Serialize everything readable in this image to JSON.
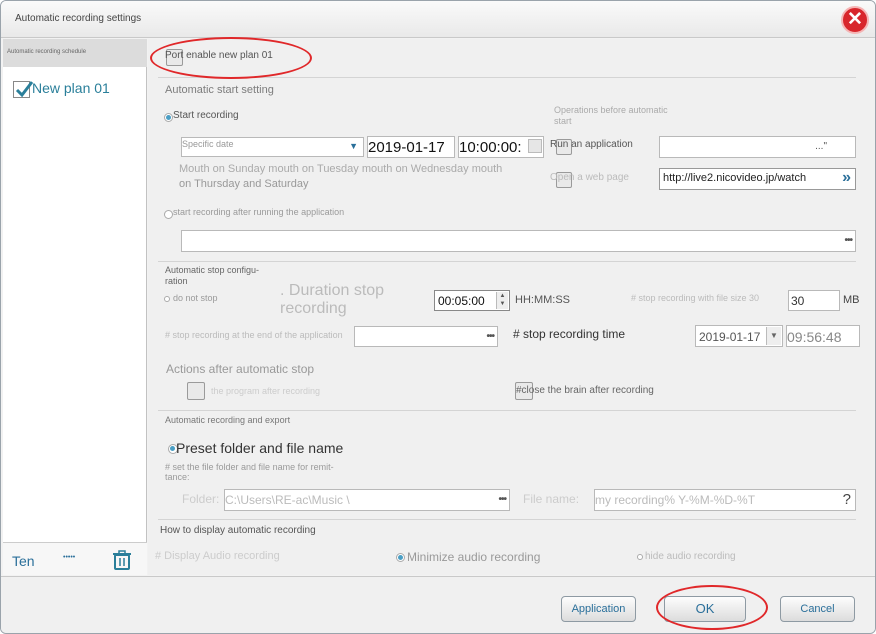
{
  "window": {
    "title": "Automatic recording settings"
  },
  "sidebar": {
    "header": "Automatic recording schedule",
    "plan_label": "New plan 01",
    "footer": {
      "add_label": "Ten",
      "mid_label": "•••••"
    }
  },
  "plan": {
    "enable_label": "Port enable new plan 01"
  },
  "start": {
    "section_title": "Automatic start setting",
    "start_recording_label": "Start recording",
    "date_mode": "Specific date",
    "date_value": "2019-01-17",
    "time_value": "10:00:00:",
    "days_text_line1": "Mouth on Sunday mouth on Tuesday mouth on Wednesday mouth",
    "days_text_line2": "on Thursday and Saturday",
    "ops_title_line1": "Operations before automatic",
    "ops_title_line2": "start",
    "run_app_label": "Run an application",
    "run_app_dots": "...\"",
    "open_page_label": "Open a web page",
    "url_value": "http://live2.nicovideo.jp/watch",
    "after_app_label": "start recording after running the application",
    "app_path_dots": "•••"
  },
  "stop": {
    "title_line1": "Automatic stop configu-",
    "title_line2": "ration",
    "do_not_stop": "do not stop",
    "duration_line1": ". Duration stop",
    "duration_line2": "recording",
    "duration_value": "00:05:00",
    "duration_format": "HH:MM:SS",
    "filesize_label": "# stop recording with file size 30",
    "filesize_value": "30",
    "filesize_unit": "MB",
    "end_app_label": "# stop recording at the end of the application",
    "end_app_dots": "•••",
    "stop_time_label": "# stop recording time",
    "stop_date": "2019-01-17",
    "stop_time": "09:56:48"
  },
  "actions": {
    "title": "Actions after automatic stop",
    "exit_program": "the program after recording",
    "close_brain": "#close the brain after recording"
  },
  "export": {
    "title": "Automatic recording and export",
    "preset_label": "Preset folder and file name",
    "custom_line1": "# set the file folder and file name for remit-",
    "custom_line2": "tance:",
    "folder_label": "Folder:",
    "folder_value": "C:\\Users\\RE-ac\\Music \\",
    "folder_dots": "•••",
    "filename_label": "File name:",
    "filename_value": "my recording% Y-%M-%D-%T",
    "help": "?"
  },
  "display": {
    "title": "How to display automatic recording",
    "display_audio": "# Display Audio recording",
    "minimize_audio": "Minimize audio recording",
    "hide_audio": "hide audio recording"
  },
  "footer": {
    "apply_label": "Application",
    "ok_label": "OK",
    "cancel_label": "Cancel"
  },
  "colors": {
    "accent": "#2a7f9a",
    "close": "#d8262c",
    "highlight_ring": "#e0282a",
    "selected_radio": "#4a9ec4"
  }
}
